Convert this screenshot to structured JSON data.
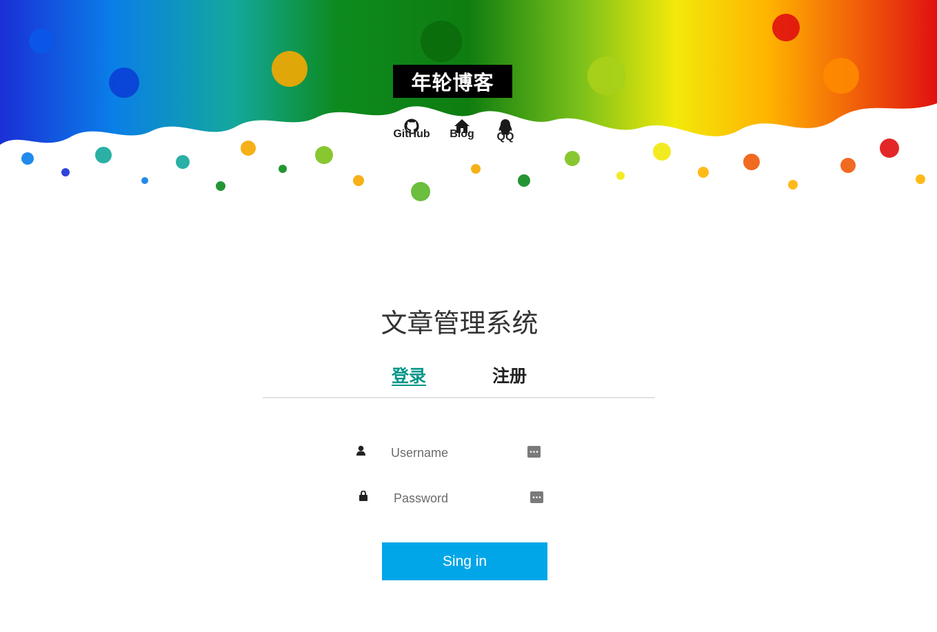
{
  "header": {
    "brand": "年轮博客",
    "links": [
      {
        "label": "GitHub",
        "icon": "github-icon"
      },
      {
        "label": "Blog",
        "icon": "home-icon"
      },
      {
        "label": "QQ",
        "icon": "qq-icon"
      }
    ]
  },
  "main": {
    "title": "文章管理系统",
    "tabs": [
      {
        "label": "登录",
        "active": true
      },
      {
        "label": "注册",
        "active": false
      }
    ],
    "username": {
      "placeholder": "Username",
      "icon": "user-icon"
    },
    "password": {
      "placeholder": "Password",
      "icon": "lock-icon"
    },
    "submit_label": "Sing in"
  },
  "colors": {
    "accent": "#009688",
    "button": "#00a6e8",
    "brand_bg": "#000000"
  }
}
